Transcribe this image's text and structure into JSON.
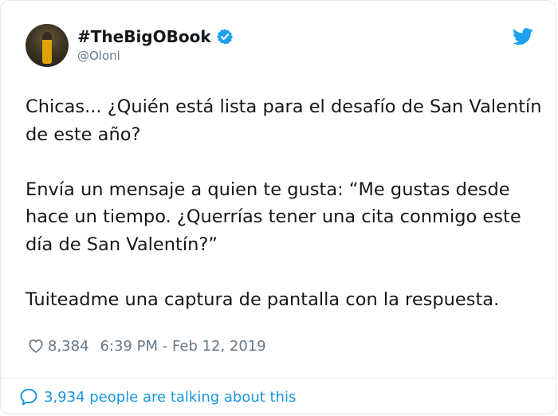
{
  "author": {
    "display_name": "#TheBigOBook",
    "handle": "@Oloni",
    "verified_icon": "verified-badge-icon",
    "avatar_icon": "avatar"
  },
  "brand": {
    "icon": "twitter-bird-icon",
    "color": "#1da1f2"
  },
  "tweet": {
    "paragraphs": [
      "Chicas... ¿Quién está lista para el desafío de San Valentín de este año?",
      "Envía un mensaje a quien te gusta: “Me gustas desde hace un tiempo. ¿Querrías tener una cita conmigo este día de San Valentín?”",
      "Tuiteadme una captura de pantalla con la respuesta."
    ]
  },
  "meta": {
    "likes": "8,384",
    "timestamp": "6:39 PM - Feb 12, 2019",
    "like_icon": "heart-icon"
  },
  "footer": {
    "talking_text": "3,934 people are talking about this",
    "icon": "reply-bubble-icon",
    "link_color": "#1b95e0"
  }
}
